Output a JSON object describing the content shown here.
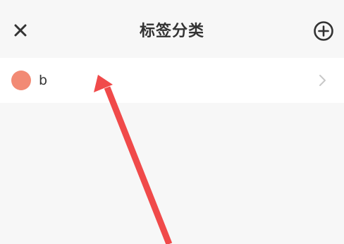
{
  "header": {
    "title": "标签分类",
    "close_icon": "close-icon",
    "add_icon": "plus-circle-icon"
  },
  "tags": [
    {
      "label": "b",
      "color": "#f28a74"
    }
  ],
  "colors": {
    "background": "#f7f7f7",
    "list_background": "#ffffff",
    "text": "#333333",
    "chevron": "#c8c8c8",
    "annotation_arrow": "#f04a4a"
  }
}
